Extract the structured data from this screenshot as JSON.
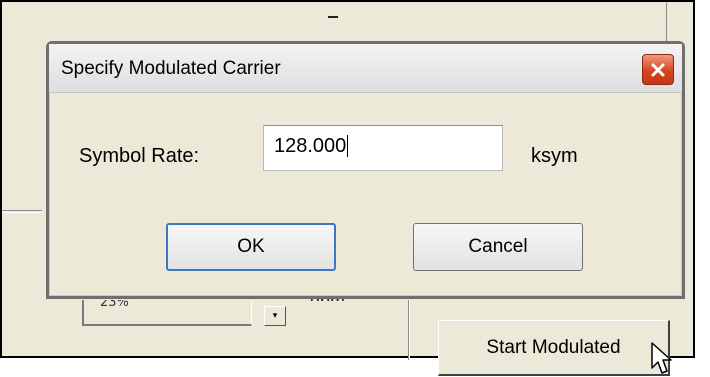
{
  "background": {
    "field_value": "23%",
    "dropdown_arrow": "▾",
    "unit_partial": "dbm",
    "start_button_label": "Start Modulated"
  },
  "dialog": {
    "title": "Specify Modulated Carrier",
    "close_icon": "close-icon",
    "symbol_rate": {
      "label": "Symbol Rate:",
      "value": "128.000",
      "unit": "ksym"
    },
    "buttons": {
      "ok": "OK",
      "cancel": "Cancel"
    }
  },
  "colors": {
    "close_button": "#d8441f",
    "ok_focus_border": "#3a77c4",
    "dialog_background": "#ece9d8"
  }
}
